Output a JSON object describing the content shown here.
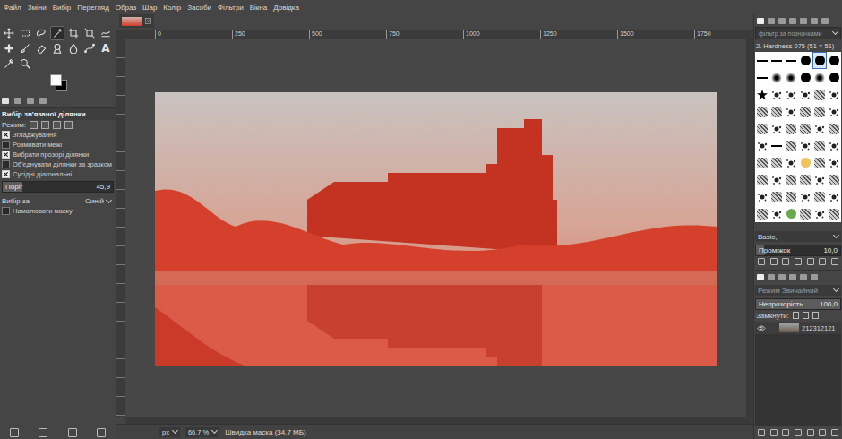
{
  "window": {
    "app": "GIMP"
  },
  "menu": [
    "Файл",
    "Зміни",
    "Вибір",
    "Перегляд",
    "Образ",
    "Шар",
    "Колір",
    "Засоби",
    "Фільтри",
    "Вікна",
    "Довідка"
  ],
  "tools": [
    {
      "kind": "move",
      "selected": false
    },
    {
      "kind": "rect-select",
      "selected": false
    },
    {
      "kind": "lasso",
      "selected": false
    },
    {
      "kind": "fuzzy-select",
      "selected": true
    },
    {
      "kind": "crop",
      "selected": false
    },
    {
      "kind": "transform",
      "selected": false
    },
    {
      "kind": "warp",
      "selected": false
    },
    {
      "kind": "heal",
      "selected": false
    },
    {
      "kind": "brush",
      "selected": false
    },
    {
      "kind": "eraser",
      "selected": false
    },
    {
      "kind": "clone",
      "selected": false
    },
    {
      "kind": "smudge",
      "selected": false
    },
    {
      "kind": "path",
      "selected": false
    },
    {
      "kind": "text",
      "glyph": "A",
      "selected": false
    },
    {
      "kind": "picker",
      "selected": false
    },
    {
      "kind": "zoom",
      "selected": false
    }
  ],
  "swatches": [
    {
      "role": "foreground",
      "color": "#ffffff"
    },
    {
      "role": "background",
      "color": "#000000"
    }
  ],
  "tool_options": {
    "title": "Вибір зв'язаної ділянки",
    "mode_label": "Режим:",
    "options": [
      {
        "label": "Згладжування",
        "checked": true
      },
      {
        "label": "Розмивати межі",
        "checked": false
      },
      {
        "label": "Вибрати прозорі ділянки",
        "checked": true
      },
      {
        "label": "Об'єднувати ділянки за зразком",
        "checked": false
      },
      {
        "label": "Сусідні діагональні",
        "checked": true
      }
    ],
    "threshold": {
      "label": "Поріг",
      "reading": "45,9",
      "level": 0.18
    },
    "select_by": {
      "label": "Вибір за",
      "value": "Синій"
    },
    "draw_mask": {
      "label": "Намалювати маску",
      "checked": false
    }
  },
  "rulers": {
    "top": [
      "0",
      "250",
      "500",
      "750",
      "1000",
      "1250",
      "1500",
      "1750"
    ]
  },
  "status_bar": {
    "unit": "px",
    "zoom": "66,7 %",
    "message": "Швидка маска (34,7 МБ)"
  },
  "brushes": {
    "filter_placeholder": "фільтр за позначками",
    "current": "2. Hardness 075 (51 × 51)",
    "items": [
      {
        "kind": "line",
        "selected": false
      },
      {
        "kind": "line",
        "selected": false
      },
      {
        "kind": "line",
        "selected": false
      },
      {
        "kind": "hard",
        "selected": false
      },
      {
        "kind": "hard",
        "selected": true
      },
      {
        "kind": "hard",
        "selected": false
      },
      {
        "kind": "line",
        "selected": false
      },
      {
        "kind": "soft",
        "selected": false
      },
      {
        "kind": "soft",
        "selected": false
      },
      {
        "kind": "hard",
        "selected": false
      },
      {
        "kind": "soft",
        "selected": false
      },
      {
        "kind": "hard",
        "selected": false
      },
      {
        "kind": "star",
        "selected": false
      },
      {
        "kind": "splat",
        "selected": false
      },
      {
        "kind": "splat",
        "selected": false
      },
      {
        "kind": "splat",
        "selected": false
      },
      {
        "kind": "texture",
        "selected": false
      },
      {
        "kind": "splat",
        "selected": false
      },
      {
        "kind": "texture",
        "selected": false
      },
      {
        "kind": "texture",
        "selected": false
      },
      {
        "kind": "splat",
        "selected": false
      },
      {
        "kind": "texture",
        "selected": false
      },
      {
        "kind": "texture",
        "selected": false
      },
      {
        "kind": "splat",
        "selected": false
      },
      {
        "kind": "texture",
        "selected": false
      },
      {
        "kind": "splat",
        "selected": false
      },
      {
        "kind": "texture",
        "selected": false
      },
      {
        "kind": "texture",
        "selected": false
      },
      {
        "kind": "splat",
        "selected": false
      },
      {
        "kind": "texture",
        "selected": false
      },
      {
        "kind": "splat",
        "selected": false
      },
      {
        "kind": "line",
        "selected": false
      },
      {
        "kind": "texture",
        "selected": false
      },
      {
        "kind": "splat",
        "selected": false
      },
      {
        "kind": "texture",
        "selected": false
      },
      {
        "kind": "splat",
        "selected": false
      },
      {
        "kind": "texture",
        "selected": false
      },
      {
        "kind": "texture",
        "selected": false
      },
      {
        "kind": "splat",
        "selected": false
      },
      {
        "kind": "color",
        "color": "#f2c35a",
        "selected": false
      },
      {
        "kind": "texture",
        "selected": false
      },
      {
        "kind": "splat",
        "selected": false
      },
      {
        "kind": "texture",
        "selected": false
      },
      {
        "kind": "splat",
        "selected": false
      },
      {
        "kind": "texture",
        "selected": false
      },
      {
        "kind": "texture",
        "selected": false
      },
      {
        "kind": "splat",
        "selected": false
      },
      {
        "kind": "texture",
        "selected": false
      },
      {
        "kind": "splat",
        "selected": false
      },
      {
        "kind": "texture",
        "selected": false
      },
      {
        "kind": "texture",
        "selected": false
      },
      {
        "kind": "splat",
        "selected": false
      },
      {
        "kind": "texture",
        "selected": false
      },
      {
        "kind": "splat",
        "selected": false
      },
      {
        "kind": "texture",
        "selected": false
      },
      {
        "kind": "splat",
        "selected": false
      },
      {
        "kind": "color",
        "color": "#6aa84f",
        "selected": false
      },
      {
        "kind": "texture",
        "selected": false
      },
      {
        "kind": "splat",
        "selected": false
      },
      {
        "kind": "texture",
        "selected": false
      }
    ],
    "preset": "Basic,",
    "spacing": {
      "label": "Проміжок",
      "reading": "10,0",
      "level": 0.1
    }
  },
  "layers": {
    "mode": {
      "label": "Режим",
      "value": "Звичайний",
      "disabled": true
    },
    "opacity": {
      "label": "Непрозорість",
      "reading": "100,0",
      "level": 1
    },
    "lock_label": "Замкнути:",
    "items": [
      {
        "name": "212312121",
        "visible": true,
        "selected": true
      }
    ]
  }
}
